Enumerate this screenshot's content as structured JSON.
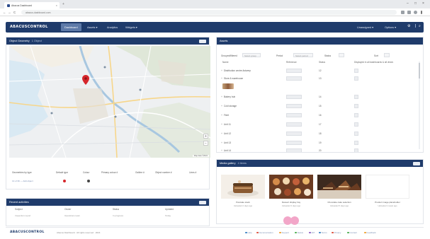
{
  "browser": {
    "tab_title": "Abacus Dashboard",
    "tab_close": "×",
    "new_tab": "+",
    "window_controls": [
      "–",
      "□",
      "×"
    ],
    "back": "←",
    "forward": "→",
    "reload": "C",
    "url": "abacus-dashboard.com"
  },
  "topbar": {
    "logo": "ABACUSCONTROL",
    "nav": [
      "Dashboard",
      "Assets ▾",
      "Analytics",
      "Widgets ▾"
    ],
    "right": [
      "Unassigned ▾",
      "Options ▾"
    ],
    "icons": [
      "gear-icon",
      "search-icon"
    ]
  },
  "map_panel": {
    "title": "Object Geometry",
    "subtitle": "1 Object",
    "zoom_in": "+",
    "zoom_out": "−",
    "credit": "Map data ©2024",
    "marker_color": "#d6262b",
    "legend": {
      "labels": [
        "Geometries by type",
        "Default type",
        "Colour",
        "Primary colour #",
        "Outline #",
        "Object number #",
        "Lines #"
      ],
      "values": [
        "13 of 36 — Add object",
        "",
        "",
        "",
        "",
        "",
        ""
      ],
      "dots": [
        "#d6262b",
        "#444444"
      ]
    }
  },
  "table_panel": {
    "title": "Assets",
    "filters": [
      {
        "label": "Grouped/filtered",
        "value": "Select group"
      },
      {
        "label": "Period",
        "value": "Select period"
      },
      {
        "label": "Status",
        "value": ""
      },
      {
        "label": "Sort",
        "value": ""
      }
    ],
    "headers": [
      "Name",
      "Reference",
      "Status",
      "Displayed in all dashboards & all views"
    ],
    "rows": [
      {
        "name": "Distribution centre Antwerp",
        "status": "12"
      },
      {
        "name": "Store & warehouse",
        "status": "13",
        "thumbnail": true
      },
      {
        "name": "Bakery hub",
        "status": "14"
      },
      {
        "name": "Cold storage",
        "status": "15"
      },
      {
        "name": "Fleet",
        "status": "16"
      },
      {
        "name": "Unit 11",
        "status": "17"
      },
      {
        "name": "Unit 12",
        "status": "18"
      },
      {
        "name": "Unit 13",
        "status": "19"
      },
      {
        "name": "Unit 14",
        "status": "20"
      }
    ]
  },
  "gallery_panel": {
    "title": "Media gallery",
    "subtitle": "4 items",
    "cards": [
      {
        "caption": "Pancake stack",
        "meta": "Uploaded 2 days ago"
      },
      {
        "caption": "Dessert display tray",
        "meta": "Uploaded 3 days ago"
      },
      {
        "caption": "Chocolate cake selection",
        "meta": "Uploaded 5 days ago"
      },
      {
        "caption": "Product image placeholder",
        "meta": "Uploaded 1 week ago"
      }
    ]
  },
  "bottom_panel": {
    "title": "Recent activities",
    "columns": [
      "Subject",
      "Owner",
      "Status",
      "Updated"
    ],
    "values": [
      "Inspection report",
      "Operations team",
      "In progress",
      "Today"
    ]
  },
  "footer": {
    "logo": "ABACUSCONTROL",
    "copyright": "Abacus Dashboard · All rights reserved · 2024",
    "links": [
      {
        "label": "Help",
        "color": "#3b82c4"
      },
      {
        "label": "Documentation",
        "color": "#e0533d"
      },
      {
        "label": "Support",
        "color": "#f0a22e"
      },
      {
        "label": "Status",
        "color": "#4caf50"
      },
      {
        "label": "API",
        "color": "#8e5cc4"
      },
      {
        "label": "Terms",
        "color": "#3b82c4"
      },
      {
        "label": "Privacy",
        "color": "#e0533d"
      },
      {
        "label": "Contact",
        "color": "#4caf50"
      },
      {
        "label": "Feedback",
        "color": "#f0a22e"
      }
    ]
  },
  "colors": {
    "navy": "#1f3b6b",
    "active_tab": "#5e7aa8"
  }
}
